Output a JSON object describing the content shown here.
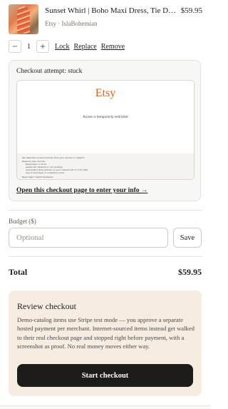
{
  "item": {
    "title": "Sunset Whirl | Boho Maxi Dress, Tie Dy…",
    "price": "$59.95",
    "source": "Etsy · IslaBohemian",
    "quantity": "1",
    "minus": "−",
    "plus": "+",
    "links": [
      "Lock",
      "Replace",
      "Remove"
    ]
  },
  "checkout_card": {
    "title": "Checkout attempt: stuck",
    "screenshot": {
      "logo": "Etsy",
      "message": "Access is temporarily restricted",
      "footer": [
        "We detected unusual activity from your device or network.",
        "Reasons may include:",
        "Rapid taps or clicks",
        "JavaScript disabled or not working",
        "Automated (bot) activity on your network (IP 4.77.27.185)",
        "Use of developer or inspection tools",
        "Need help? Submit feedback."
      ]
    },
    "link": "Open this checkout page to enter your info →"
  },
  "budget": {
    "label": "Budget ($)",
    "placeholder": "Optional",
    "save": "Save"
  },
  "total": {
    "label": "Total",
    "value": "$59.95"
  },
  "review": {
    "title": "Review checkout",
    "body": "Demo-catalog items use Stripe test mode — you approve a separate hosted payment per merchant. Internet-sourced items instead get walked to their real checkout page and stopped right before payment, with a screenshot as proof. No real money moves either way.",
    "button": "Start checkout"
  }
}
